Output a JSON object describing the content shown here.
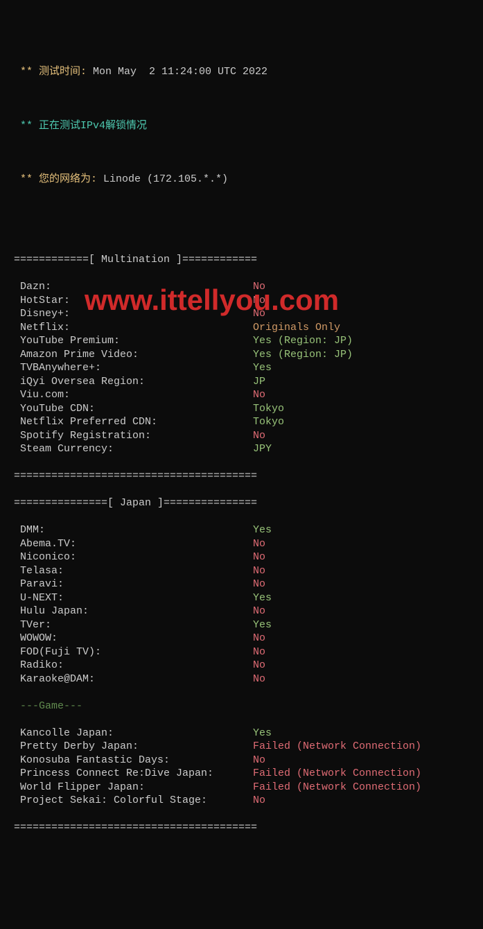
{
  "header": {
    "test_time_label": " ** 测试时间: ",
    "test_time_value": "Mon May  2 11:24:00 UTC 2022",
    "testing_label": " ** 正在测试IPv4解锁情况",
    "network_label": " ** 您的网络为: ",
    "network_value": "Linode (172.105.*.*)"
  },
  "sections": {
    "multination": {
      "separator": "============[ Multination ]============",
      "items": [
        {
          "label": " Dazn:",
          "value": "No",
          "valueClass": "red"
        },
        {
          "label": " HotStar:",
          "value": "No",
          "valueClass": "red"
        },
        {
          "label": " Disney+:",
          "value": "No",
          "valueClass": "red"
        },
        {
          "label": " Netflix:",
          "value": "Originals Only",
          "valueClass": "gold"
        },
        {
          "label": " YouTube Premium:",
          "value": "Yes (Region: JP)",
          "valueClass": "green"
        },
        {
          "label": " Amazon Prime Video:",
          "value": "Yes (Region: JP)",
          "valueClass": "green"
        },
        {
          "label": " TVBAnywhere+:",
          "value": "Yes",
          "valueClass": "green"
        },
        {
          "label": " iQyi Oversea Region:",
          "value": "JP",
          "valueClass": "green"
        },
        {
          "label": " Viu.com:",
          "value": "No",
          "valueClass": "red"
        },
        {
          "label": " YouTube CDN:",
          "value": "Tokyo",
          "valueClass": "green"
        },
        {
          "label": " Netflix Preferred CDN:",
          "value": "Tokyo",
          "valueClass": "green"
        },
        {
          "label": " Spotify Registration:",
          "value": "No",
          "valueClass": "red"
        },
        {
          "label": " Steam Currency:",
          "value": "JPY",
          "valueClass": "green"
        }
      ],
      "separator_end": "======================================="
    },
    "japan": {
      "separator": "===============[ Japan ]===============",
      "items": [
        {
          "label": " DMM:",
          "value": "Yes",
          "valueClass": "green"
        },
        {
          "label": " Abema.TV:",
          "value": "No",
          "valueClass": "red"
        },
        {
          "label": " Niconico:",
          "value": "No",
          "valueClass": "red"
        },
        {
          "label": " Telasa:",
          "value": "No",
          "valueClass": "red"
        },
        {
          "label": " Paravi:",
          "value": "No",
          "valueClass": "red"
        },
        {
          "label": " U-NEXT:",
          "value": "Yes",
          "valueClass": "green"
        },
        {
          "label": " Hulu Japan:",
          "value": "No",
          "valueClass": "red"
        },
        {
          "label": " TVer:",
          "value": "Yes",
          "valueClass": "green"
        },
        {
          "label": " WOWOW:",
          "value": "No",
          "valueClass": "red"
        },
        {
          "label": " FOD(Fuji TV):",
          "value": "No",
          "valueClass": "red"
        },
        {
          "label": " Radiko:",
          "value": "No",
          "valueClass": "red"
        },
        {
          "label": " Karaoke@DAM:",
          "value": "No",
          "valueClass": "red"
        }
      ],
      "game_label": " ---Game---",
      "game_items": [
        {
          "label": " Kancolle Japan:",
          "value": "Yes",
          "valueClass": "green"
        },
        {
          "label": " Pretty Derby Japan:",
          "value": "Failed (Network Connection)",
          "valueClass": "red"
        },
        {
          "label": " Konosuba Fantastic Days:",
          "value": "No",
          "valueClass": "red"
        },
        {
          "label": " Princess Connect Re:Dive Japan:",
          "value": "Failed (Network Connection)",
          "valueClass": "red"
        },
        {
          "label": " World Flipper Japan:",
          "value": "Failed (Network Connection)",
          "valueClass": "red"
        },
        {
          "label": " Project Sekai: Colorful Stage:",
          "value": "No",
          "valueClass": "red"
        }
      ],
      "separator_end": "======================================="
    }
  },
  "watermark": "www.ittellyou.com"
}
